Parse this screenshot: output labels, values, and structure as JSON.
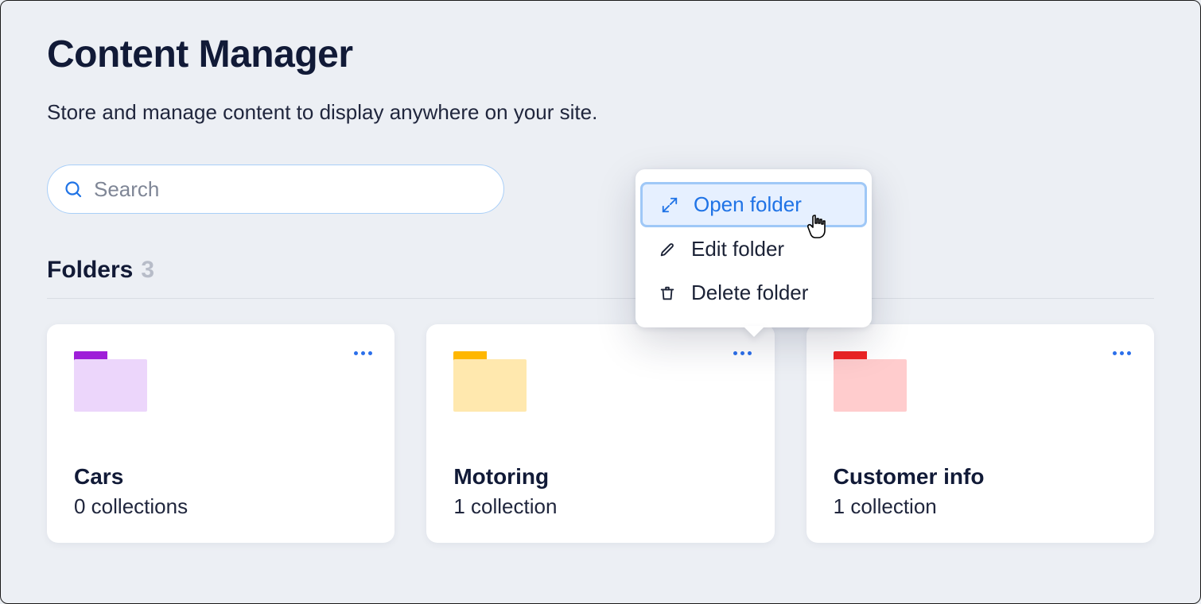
{
  "header": {
    "title": "Content Manager",
    "subtitle": "Store and manage content to display anywhere on your site."
  },
  "search": {
    "placeholder": "Search",
    "value": ""
  },
  "folders_section": {
    "title": "Folders",
    "count": "3",
    "items": [
      {
        "name": "Cars",
        "sub": "0 collections",
        "color": "purple"
      },
      {
        "name": "Motoring",
        "sub": "1 collection",
        "color": "yellow"
      },
      {
        "name": "Customer info",
        "sub": "1 collection",
        "color": "red"
      }
    ]
  },
  "context_menu": {
    "items": [
      {
        "label": "Open folder",
        "icon": "expand-icon",
        "active": true
      },
      {
        "label": "Edit folder",
        "icon": "pencil-icon",
        "active": false
      },
      {
        "label": "Delete folder",
        "icon": "trash-icon",
        "active": false
      }
    ]
  }
}
